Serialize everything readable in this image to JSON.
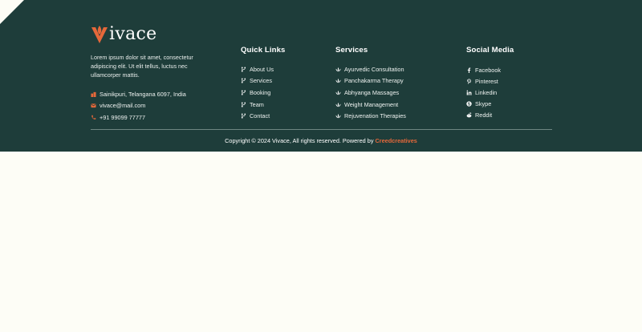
{
  "colors": {
    "background": "#1e3d3a",
    "accent": "#e5683a",
    "page": "#fdfdf6"
  },
  "brand": {
    "name": "ivace",
    "logo_icon": "lotus-v-icon"
  },
  "about": {
    "text": "Lorem ipsum dolor sit amet, consectetur adipiscing elit. Ut elit tellus, luctus nec ullamcorper mattis."
  },
  "contact": {
    "address": "Sainikpuri, Telangana 6097, India",
    "email": "vivace@mail.com",
    "phone": "+91 99099 77777"
  },
  "quick_links": {
    "title": "Quick Links",
    "items": [
      {
        "label": "About Us"
      },
      {
        "label": "Services"
      },
      {
        "label": "Booking"
      },
      {
        "label": "Team"
      },
      {
        "label": "Contact"
      }
    ]
  },
  "services": {
    "title": "Services",
    "items": [
      {
        "label": "Ayurvedic Consultation"
      },
      {
        "label": "Panchakarma Therapy"
      },
      {
        "label": "Abhyanga Massages"
      },
      {
        "label": "Weight Management"
      },
      {
        "label": "Rejuvenation Therapies"
      }
    ]
  },
  "social": {
    "title": "Social Media",
    "items": [
      {
        "label": "Facebook",
        "icon": "facebook-icon"
      },
      {
        "label": "Pinterest",
        "icon": "pinterest-icon"
      },
      {
        "label": "Linkedin",
        "icon": "linkedin-icon"
      },
      {
        "label": "Skype",
        "icon": "skype-icon"
      },
      {
        "label": "Reddit",
        "icon": "reddit-icon"
      }
    ]
  },
  "copyright": {
    "text": "Copyright © 2024 Vivace, All rights reserved. Powered by ",
    "link": "Creedcreatives"
  }
}
